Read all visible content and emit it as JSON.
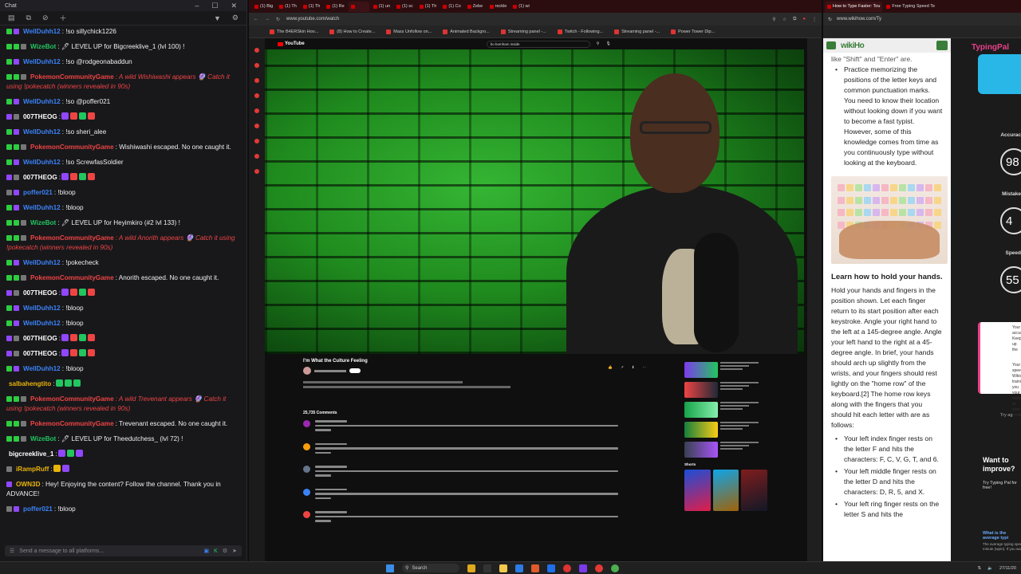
{
  "chat": {
    "window_title": "Chat",
    "input_placeholder": "Send a message to all platforms...",
    "messages": [
      {
        "user": "WellDuhh12",
        "color": "#3b82f6",
        "text": ": !so sillychick1226",
        "badges": [
          "green",
          "purple"
        ],
        "emotes": []
      },
      {
        "user": "WizeBot",
        "color": "#22c55e",
        "text": ": 🖊 LEVEL UP for Bigcreeklive_1 (lvl 100) !",
        "badges": [
          "green",
          "green",
          "gray"
        ],
        "emotes": []
      },
      {
        "user": "WellDuhh12",
        "color": "#3b82f6",
        "text": ": !so @rodgeonabaddun",
        "badges": [
          "green",
          "purple"
        ],
        "emotes": []
      },
      {
        "user": "PokemonCommunityGame",
        "color": "#ef4444",
        "text": ": A wild Wishiwashi appears 🔮 Catch it using !pokecatch (winners revealed in 90s)",
        "badges": [
          "green",
          "green",
          "gray"
        ],
        "emotes": [],
        "action": true
      },
      {
        "user": "WellDuhh12",
        "color": "#3b82f6",
        "text": ": !so @poffer021",
        "badges": [
          "green",
          "purple"
        ],
        "emotes": []
      },
      {
        "user": "007THEOG",
        "color": "#ffffff",
        "text": ":",
        "badges": [
          "purple",
          "gray"
        ],
        "emotes": [
          "#9147ff",
          "#ef4444",
          "#22c55e",
          "#ef4444"
        ]
      },
      {
        "user": "WellDuhh12",
        "color": "#3b82f6",
        "text": ": !so sheri_alee",
        "badges": [
          "green",
          "purple"
        ],
        "emotes": []
      },
      {
        "user": "PokemonCommunityGame",
        "color": "#ef4444",
        "text": ": Wishiwashi escaped. No one caught it.",
        "badges": [
          "green",
          "green",
          "gray"
        ],
        "emotes": []
      },
      {
        "user": "WellDuhh12",
        "color": "#3b82f6",
        "text": ": !so ScrewfasSoldier",
        "badges": [
          "green",
          "purple"
        ],
        "emotes": []
      },
      {
        "user": "007THEOG",
        "color": "#ffffff",
        "text": ":",
        "badges": [
          "purple",
          "gray"
        ],
        "emotes": [
          "#9147ff",
          "#ef4444",
          "#22c55e",
          "#ef4444"
        ]
      },
      {
        "user": "poffer021",
        "color": "#3b82f6",
        "text": ": !bloop",
        "badges": [
          "gray",
          "purple"
        ],
        "emotes": []
      },
      {
        "user": "WellDuhh12",
        "color": "#3b82f6",
        "text": ": !bloop",
        "badges": [
          "green",
          "purple"
        ],
        "emotes": []
      },
      {
        "user": "WizeBot",
        "color": "#22c55e",
        "text": ": 🖊 LEVEL UP for Heyimkiro (#2 lvl 133) !",
        "badges": [
          "green",
          "green",
          "gray"
        ],
        "emotes": []
      },
      {
        "user": "PokemonCommunityGame",
        "color": "#ef4444",
        "text": ": A wild Anorith appears 🔮 Catch it using !pokecatch (winners revealed in 90s)",
        "badges": [
          "green",
          "green",
          "gray"
        ],
        "emotes": [],
        "action": true
      },
      {
        "user": "WellDuhh12",
        "color": "#3b82f6",
        "text": ": !pokecheck",
        "badges": [
          "green",
          "purple"
        ],
        "emotes": []
      },
      {
        "user": "PokemonCommunityGame",
        "color": "#ef4444",
        "text": ": Anorith escaped. No one caught it.",
        "badges": [
          "green",
          "green",
          "gray"
        ],
        "emotes": []
      },
      {
        "user": "007THEOG",
        "color": "#ffffff",
        "text": ":",
        "badges": [
          "purple",
          "gray"
        ],
        "emotes": [
          "#9147ff",
          "#ef4444",
          "#22c55e",
          "#ef4444"
        ]
      },
      {
        "user": "WellDuhh12",
        "color": "#3b82f6",
        "text": ": !bloop",
        "badges": [
          "green",
          "purple"
        ],
        "emotes": []
      },
      {
        "user": "WellDuhh12",
        "color": "#3b82f6",
        "text": ": !bloop",
        "badges": [
          "green",
          "purple"
        ],
        "emotes": []
      },
      {
        "user": "007THEOG",
        "color": "#ffffff",
        "text": ":",
        "badges": [
          "purple",
          "gray"
        ],
        "emotes": [
          "#9147ff",
          "#ef4444",
          "#22c55e",
          "#ef4444"
        ]
      },
      {
        "user": "007THEOG",
        "color": "#ffffff",
        "text": ":",
        "badges": [
          "purple",
          "gray"
        ],
        "emotes": [
          "#9147ff",
          "#ef4444",
          "#22c55e",
          "#ef4444"
        ]
      },
      {
        "user": "WellDuhh12",
        "color": "#3b82f6",
        "text": ": !bloop",
        "badges": [
          "green",
          "purple"
        ],
        "emotes": []
      },
      {
        "user": "salbahengtito",
        "color": "#eab308",
        "text": ":",
        "badges": [],
        "emotes": [
          "#22c55e",
          "#22c55e",
          "#22c55e"
        ]
      },
      {
        "user": "PokemonCommunityGame",
        "color": "#ef4444",
        "text": ": A wild Trevenant appears 🔮 Catch it using !pokecatch (winners revealed in 90s)",
        "badges": [
          "green",
          "green",
          "gray"
        ],
        "emotes": [],
        "action": true
      },
      {
        "user": "PokemonCommunityGame",
        "color": "#ef4444",
        "text": ": Trevenant escaped. No one caught it.",
        "badges": [
          "green",
          "green",
          "gray"
        ],
        "emotes": []
      },
      {
        "user": "WizeBot",
        "color": "#22c55e",
        "text": ": 🖊 LEVEL UP for Theedutchess_ (lvl 72) !",
        "badges": [
          "green",
          "green",
          "gray"
        ],
        "emotes": []
      },
      {
        "user": "bigcreeklive_1",
        "color": "#ffffff",
        "text": ":",
        "badges": [],
        "emotes": [
          "#9147ff",
          "#22c55e",
          "#9147ff"
        ]
      },
      {
        "user": "iRampRuff",
        "color": "#eab308",
        "text": ":",
        "badges": [
          "gray"
        ],
        "emotes": [
          "#eab308",
          "#9147ff"
        ]
      },
      {
        "user": "OWN3D",
        "color": "#eab308",
        "text": ": Hey! Enjoying the content? Follow the channel. Thank you in ADVANCE!",
        "badges": [
          "purple"
        ],
        "emotes": []
      },
      {
        "user": "poffer021",
        "color": "#3b82f6",
        "text": ": !bloop",
        "badges": [
          "gray",
          "purple"
        ],
        "emotes": []
      }
    ]
  },
  "youtube": {
    "url": "www.youtube.com/watch",
    "bookmarks": [
      "The B4ERSkin Hoo...",
      "(8) How to Create...",
      "Mass Unfollow on...",
      "Animated Backgro...",
      "Streaming panel -...",
      "Twitch - Following...",
      "Streaming panel -...",
      "Power Tower Dip..."
    ],
    "tabs": [
      "(1) Big",
      "(1) Th",
      "(1) Th",
      "(1) Re",
      "",
      "(1) un",
      "(1) sc",
      "(1) Th",
      "(1) Co",
      "Zebe",
      "reckle",
      "(1) wi"
    ],
    "search": "bo bomham inside",
    "logo": "YouTube",
    "video_title": "I'm What the Culture Feeling",
    "comments_count": "25,735 Comments",
    "shorts_label": "Shorts"
  },
  "wikihow": {
    "url": "www.wikihow.com/Ty",
    "tab_title": "How to Type Faster: Tou",
    "tab2_title": "Free Typing Speed Te",
    "logo": "wikiHo",
    "intro_fragment": "like \"Shift\" and \"Enter\" are.",
    "bullet_top": "Practice memorizing the positions of the letter keys and common punctuation marks. You need to know their location without looking down if you want to become a fast typist. However, some of this knowledge comes from time as you continuously type without looking at the keyboard.",
    "section_title": "Learn how to hold your hands.",
    "section_body": "Hold your hands and fingers in the position shown. Let each finger return to its start position after each keystroke. Angle your right hand to the left at a 145-degree angle. Angle your left hand to the right at a 45-degree angle. In brief, your hands should arch up slightly from the wrists, and your fingers should rest lightly on the \"home row\" of the keyboard.[2] The home row keys along with the fingers that you should hit each letter with are as follows:",
    "bullets": [
      "Your left index finger rests on the letter F and hits the characters: F, C, V, G, T, and 6.",
      "Your left middle finger rests on the letter D and hits the characters: D, R, 5, and X.",
      "Your left ring finger rests on the letter S and hits the"
    ]
  },
  "typingpal": {
    "logo": "TypingPal",
    "accuracy_label": "Accurac",
    "accuracy_value": "98",
    "mistakes_label": "Mistake",
    "mistakes_value": "4",
    "speed_label": "Speed",
    "speed_value": "55",
    "card_text_1": "Your accura Keep up the",
    "card_text_2": "Your speed Wikis training, you your skills ar your product",
    "retry": "Try ag",
    "want": "Want to improve?",
    "try_free": "Try Typing Pal for free!",
    "avg_q": "What is the average typi",
    "avg_a": "The average typing speed per minute (wpm). If you wan"
  },
  "taskbar": {
    "search": "Search",
    "date": "27/11/20"
  }
}
